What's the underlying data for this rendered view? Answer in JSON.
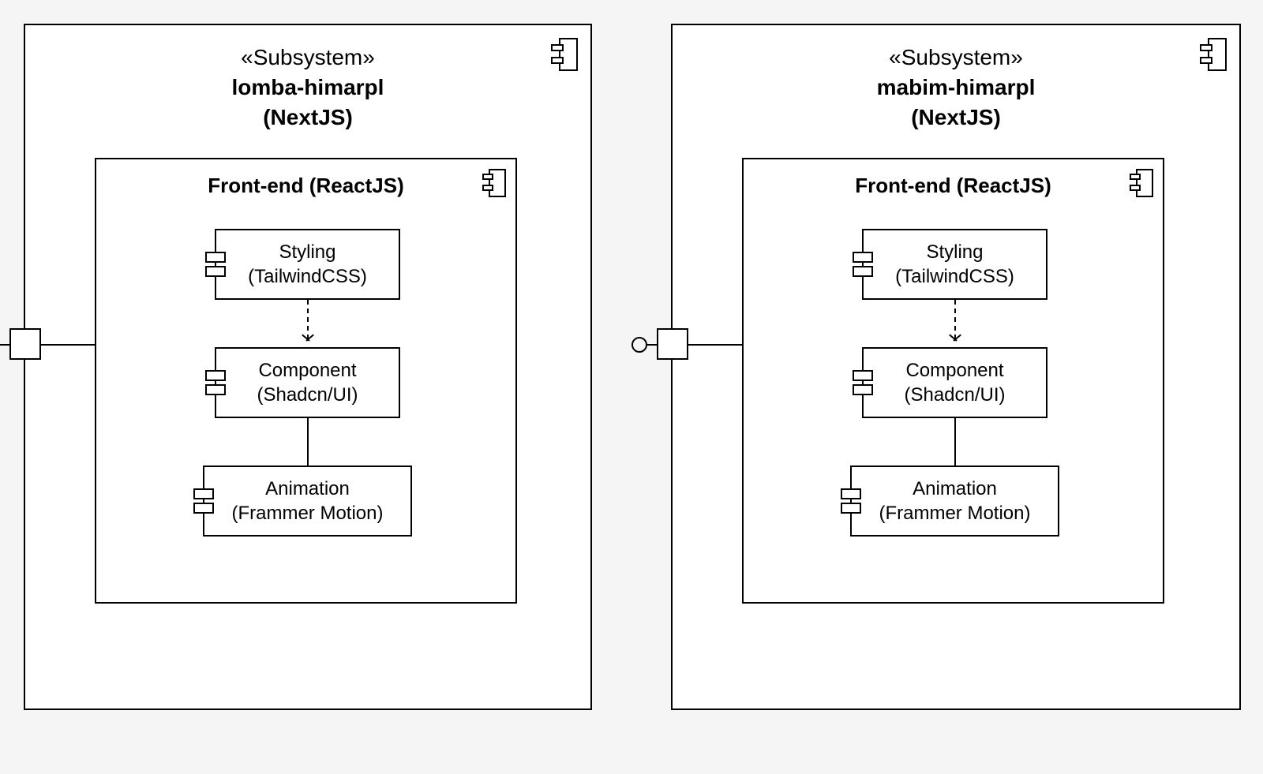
{
  "stereotype": "«Subsystem»",
  "subsystems": [
    {
      "name": "lomba-himarpl",
      "tech": "(NextJS)",
      "frontend": {
        "title": "Front-end (ReactJS)",
        "components": [
          {
            "line1": "Styling",
            "line2": "(TailwindCSS)"
          },
          {
            "line1": "Component",
            "line2": "(Shadcn/UI)"
          },
          {
            "line1": "Animation",
            "line2": "(Frammer Motion)"
          }
        ],
        "relations": [
          {
            "from": 0,
            "to": 1,
            "type": "dependency"
          },
          {
            "from": 1,
            "to": 2,
            "type": "association"
          }
        ]
      }
    },
    {
      "name": "mabim-himarpl",
      "tech": "(NextJS)",
      "frontend": {
        "title": "Front-end (ReactJS)",
        "components": [
          {
            "line1": "Styling",
            "line2": "(TailwindCSS)"
          },
          {
            "line1": "Component",
            "line2": "(Shadcn/UI)"
          },
          {
            "line1": "Animation",
            "line2": "(Frammer Motion)"
          }
        ],
        "relations": [
          {
            "from": 0,
            "to": 1,
            "type": "dependency"
          },
          {
            "from": 1,
            "to": 2,
            "type": "association"
          }
        ]
      }
    }
  ]
}
